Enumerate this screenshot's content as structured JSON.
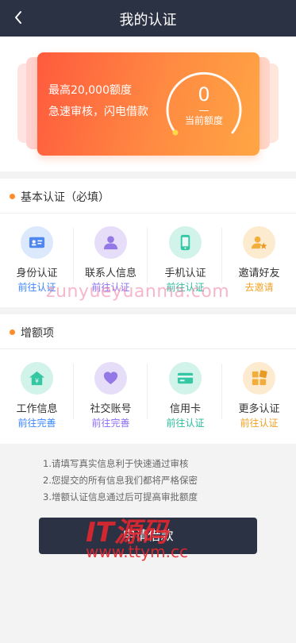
{
  "header": {
    "title": "我的认证"
  },
  "banner": {
    "line1": "最高20,000额度",
    "line2": "急速审核，闪电借款",
    "amount": "0",
    "amount_label": "当前额度"
  },
  "basic_section": {
    "title": "基本认证（必填）",
    "items": [
      {
        "label": "身份认证",
        "action": "前往认证",
        "icon": "id-card-icon",
        "action_color": "#3a86ff",
        "icon_bg": "#dce9fd",
        "icon_color": "#4f87f0"
      },
      {
        "label": "联系人信息",
        "action": "前往认证",
        "icon": "user-icon",
        "action_color": "#8b6ef0",
        "icon_bg": "#e6def9",
        "icon_color": "#9378e6"
      },
      {
        "label": "手机认证",
        "action": "前往认证",
        "icon": "phone-icon",
        "action_color": "#2bbb9b",
        "icon_bg": "#d2f3e9",
        "icon_color": "#35c7a4"
      },
      {
        "label": "邀请好友",
        "action": "去邀请",
        "icon": "invite-friend-icon",
        "action_color": "#f0a224",
        "icon_bg": "#fdebd0",
        "icon_color": "#f3ad3b"
      }
    ]
  },
  "plus_section": {
    "title": "增额项",
    "items": [
      {
        "label": "工作信息",
        "action": "前往完善",
        "icon": "work-house-icon",
        "action_color": "#3a86ff",
        "icon_bg": "#dce9fd",
        "icon_color": "#4f87f0"
      },
      {
        "label": "社交账号",
        "action": "前往完善",
        "icon": "social-heart-icon",
        "action_color": "#8b6ef0",
        "icon_bg": "#e6def9",
        "icon_color": "#9378e6"
      },
      {
        "label": "信用卡",
        "action": "前往认证",
        "icon": "credit-card-icon",
        "action_color": "#2bbb9b",
        "icon_bg": "#d2f3e9",
        "icon_color": "#35c7a4"
      },
      {
        "label": "更多认证",
        "action": "前往认证",
        "icon": "more-grid-icon",
        "action_color": "#f0a224",
        "icon_bg": "#fdebd0",
        "icon_color": "#f3ad3b"
      }
    ]
  },
  "tips": [
    "1.请填写真实信息利于快速通过审核",
    "2.您提交的所有信息我们都将严格保密",
    "3.增额认证信息通过后可提高审批额度"
  ],
  "apply_button": "申请借款",
  "watermarks": {
    "text1": "zunyueyuanma.com",
    "text2": "IT源码",
    "text3": "www.ttym.cc"
  }
}
